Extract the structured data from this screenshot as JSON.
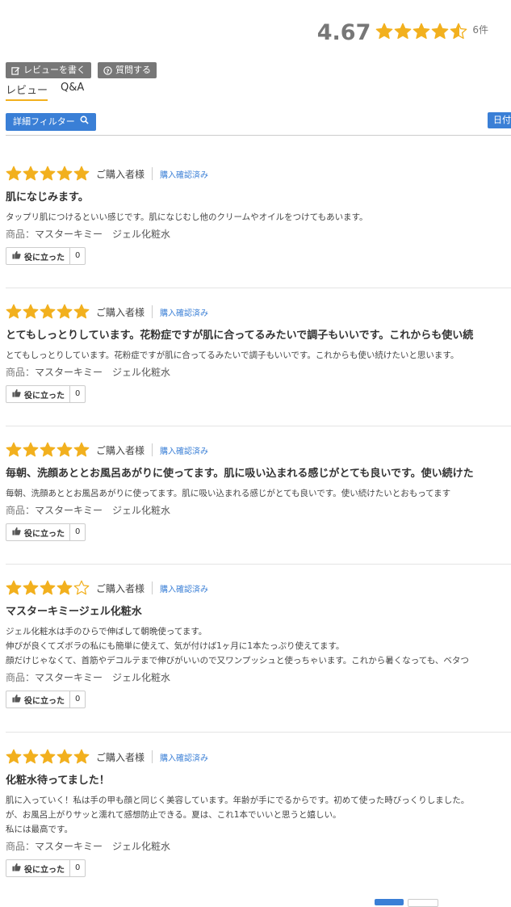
{
  "summary": {
    "average": "4.67",
    "rating": 4.67,
    "count": "6件"
  },
  "actions": {
    "write_review": "レビューを書く",
    "ask_question": "質問する"
  },
  "tabs": [
    {
      "label": "レビュー",
      "active": true
    },
    {
      "label": "Q&A",
      "active": false
    }
  ],
  "filter": {
    "label": "詳細フィルター"
  },
  "sort": {
    "label": "日付"
  },
  "colors": {
    "star": "#f2b01e",
    "accent": "#3a7fd6",
    "button_gray": "#777777"
  },
  "reviews": [
    {
      "rating": 5,
      "buyer": "ご購入者様",
      "verified": "購入確認済み",
      "title": "肌になじみます。",
      "body": [
        "タップリ肌につけるといい感じです。肌になじむし他のクリームやオイルをつけてもあいます。"
      ],
      "product_label": "商品：",
      "product": "マスターキミー　ジェル化粧水",
      "helpful_label": "役に立った",
      "helpful_count": "0"
    },
    {
      "rating": 5,
      "buyer": "ご購入者様",
      "verified": "購入確認済み",
      "title": "とてもしっとりしています。花粉症ですが肌に合ってるみたいで調子もいいです。これからも使い続",
      "body": [
        "とてもしっとりしています。花粉症ですが肌に合ってるみたいで調子もいいです。これからも使い続けたいと思います。"
      ],
      "product_label": "商品：",
      "product": "マスターキミー　ジェル化粧水",
      "helpful_label": "役に立った",
      "helpful_count": "0"
    },
    {
      "rating": 5,
      "buyer": "ご購入者様",
      "verified": "購入確認済み",
      "title": "毎朝、洗顔あととお風呂あがりに使ってます。肌に吸い込まれる感じがとても良いです。使い続けた",
      "body": [
        "毎朝、洗顔あととお風呂あがりに使ってます。肌に吸い込まれる感じがとても良いです。使い続けたいとおもってます"
      ],
      "product_label": "商品：",
      "product": "マスターキミー　ジェル化粧水",
      "helpful_label": "役に立った",
      "helpful_count": "0"
    },
    {
      "rating": 4,
      "buyer": "ご購入者様",
      "verified": "購入確認済み",
      "title": "マスターキミージェル化粧水",
      "body": [
        "ジェル化粧水は手のひらで伸ばして朝晩使ってます。",
        "伸びが良くてズボラの私にも簡単に使えて、気が付けば1ヶ月に1本たっぷり使えてます。",
        "顔だけじゃなくて、首筋やデコルテまで伸びがいいので又ワンプッシュと使っちゃいます。これから暑くなっても、ベタつ"
      ],
      "product_label": "商品：",
      "product": "マスターキミー　ジェル化粧水",
      "helpful_label": "役に立った",
      "helpful_count": "0"
    },
    {
      "rating": 5,
      "buyer": "ご購入者様",
      "verified": "購入確認済み",
      "title": "化粧水待ってました！",
      "body": [
        "肌に入っていく！私は手の甲も顔と同じく美容しています。年齢が手にでるからです。初めて使った時びっくりしました。",
        "が、お風呂上がりサッと濡れて感想防止できる。夏は、これ1本でいいと思うと嬉しい。",
        "私には最高です。"
      ],
      "product_label": "商品：",
      "product": "マスターキミー　ジェル化粧水",
      "helpful_label": "役に立った",
      "helpful_count": "0"
    }
  ]
}
